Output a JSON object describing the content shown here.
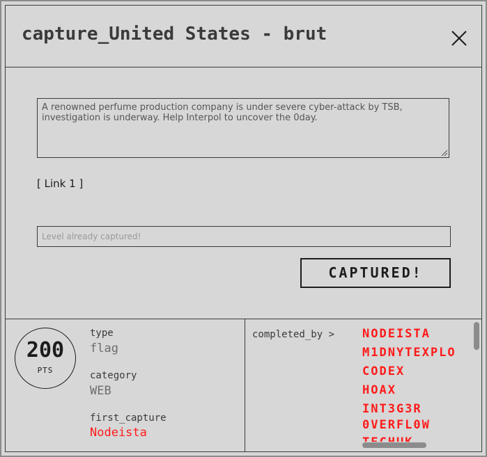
{
  "dialog": {
    "title": "capture_United States - brut",
    "close_icon": "close-x-icon"
  },
  "challenge": {
    "description": "A renowned perfume production company is under severe cyber-attack by TSB, investigation is underway. Help Interpol to uncover the 0day.",
    "link_label": "[ Link 1 ]",
    "flag_placeholder": "Level already captured!",
    "submit_label": "CAPTURED!"
  },
  "stats": {
    "points": "200",
    "points_unit": "PTS",
    "type_label": "type",
    "type_value": "flag",
    "category_label": "category",
    "category_value": "WEB",
    "first_capture_label": "first_capture",
    "first_capture_value": "Nodeista"
  },
  "completed": {
    "label": "completed_by >",
    "users": [
      "NODEISTA",
      "M1DNYTEXPLO",
      "CODEX",
      "HOAX",
      "INT3G3R 0VERFL0W",
      "TECHUK"
    ]
  },
  "colors": {
    "background": "#d7d7d7",
    "accent_red": "#ff1a1a",
    "border": "#3a3a3a"
  }
}
